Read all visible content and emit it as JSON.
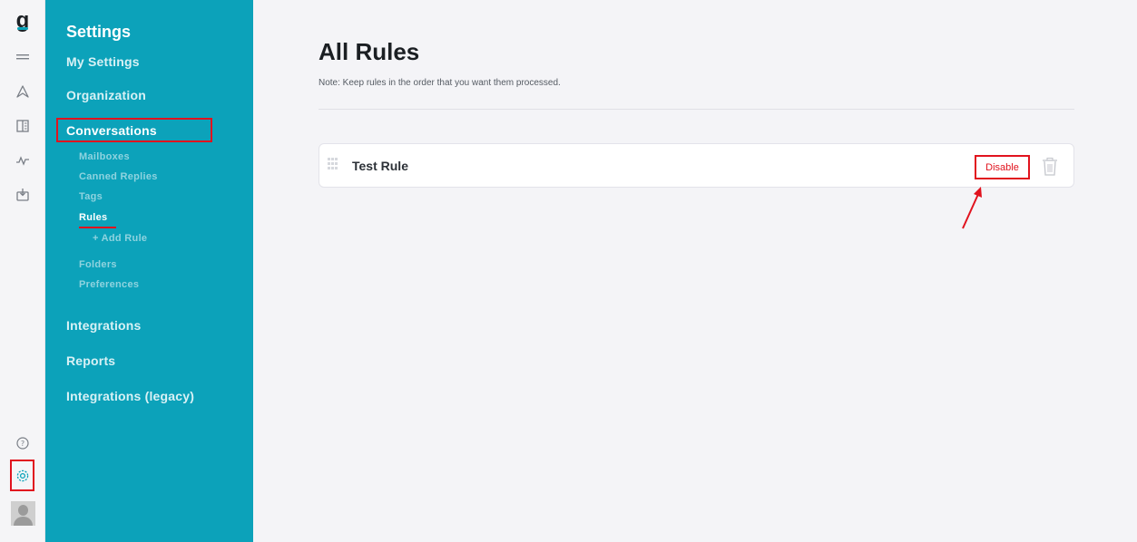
{
  "rail": {
    "logo_char": "g",
    "icons": [
      "menu-icon",
      "send-icon",
      "book-icon",
      "activity-icon",
      "inbox-icon",
      "help-icon",
      "gear-icon",
      "avatar"
    ],
    "accent_color": "#09a2b8"
  },
  "sidebar": {
    "title": "Settings",
    "background_color": "#0ca2ba",
    "sections": [
      {
        "label": "My Settings"
      },
      {
        "label": "Organization"
      },
      {
        "label": "Conversations",
        "highlighted": true
      },
      {
        "label": "Integrations"
      },
      {
        "label": "Reports"
      },
      {
        "label": "Integrations (legacy)"
      }
    ],
    "conversation_items": [
      {
        "label": "Mailboxes"
      },
      {
        "label": "Canned Replies"
      },
      {
        "label": "Tags"
      },
      {
        "label": "Rules",
        "active": true
      },
      {
        "label": "+ Add Rule"
      },
      {
        "label": "Folders"
      },
      {
        "label": "Preferences"
      }
    ]
  },
  "main": {
    "title": "All Rules",
    "note": "Note: Keep rules in the order that you want them processed.",
    "rules": [
      {
        "name": "Test Rule",
        "disable_label": "Disable"
      }
    ]
  },
  "annotation_color": "#e1131e"
}
